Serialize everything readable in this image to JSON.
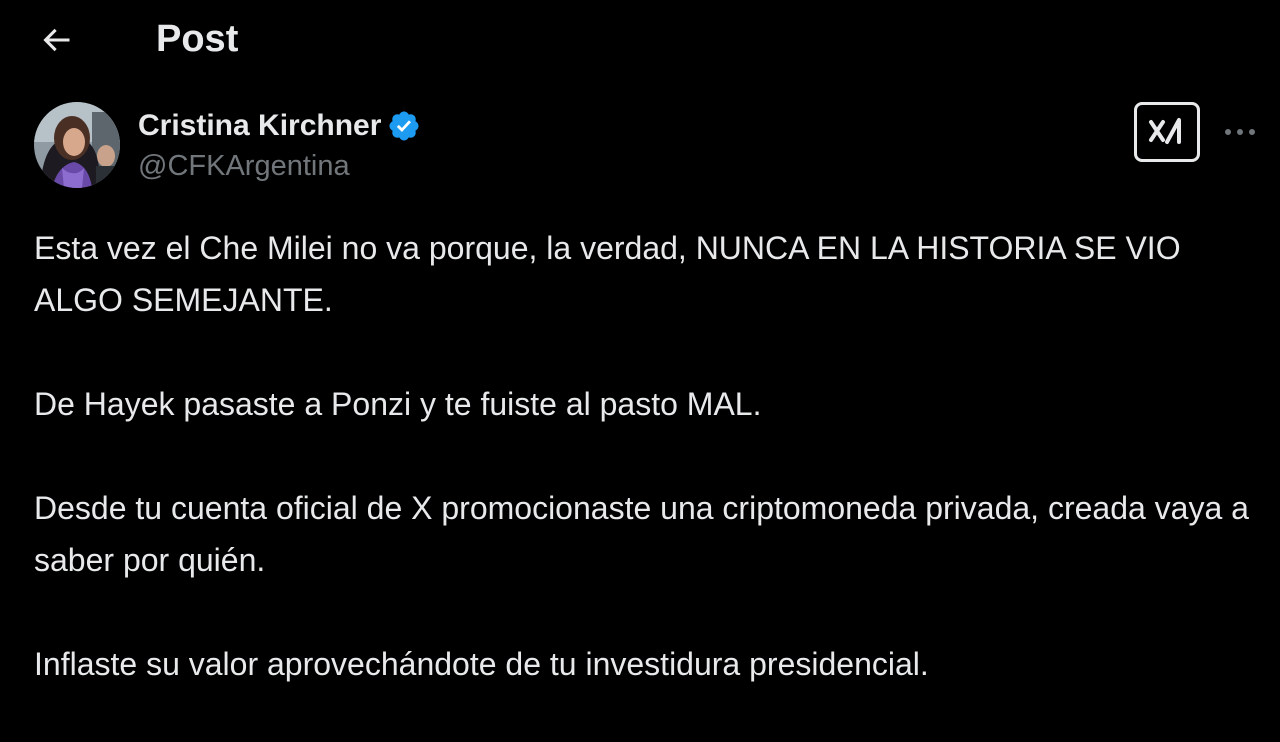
{
  "header": {
    "back_icon": "arrow-left-icon",
    "title": "Post"
  },
  "author": {
    "display_name": "Cristina Kirchner",
    "handle": "@CFKArgentina",
    "verified_icon": "verified-badge-icon",
    "verified_color": "#1d9bf0"
  },
  "actions": {
    "grok_icon": "grok-icon",
    "more_icon": "more-horizontal-icon"
  },
  "post": {
    "paragraphs": [
      "Esta vez el Che Milei no va porque, la verdad, NUNCA EN LA HISTORIA SE VIO ALGO SEMEJANTE.",
      "De Hayek pasaste a Ponzi y te fuiste al pasto MAL.",
      "Desde tu cuenta oficial de X promocionaste una criptomoneda privada, creada vaya a saber por quién.",
      "Inflaste su valor aprovechándote de tu investidura presidencial."
    ]
  },
  "colors": {
    "background": "#000000",
    "text": "#e7e9ea",
    "secondary_text": "#71767b"
  }
}
